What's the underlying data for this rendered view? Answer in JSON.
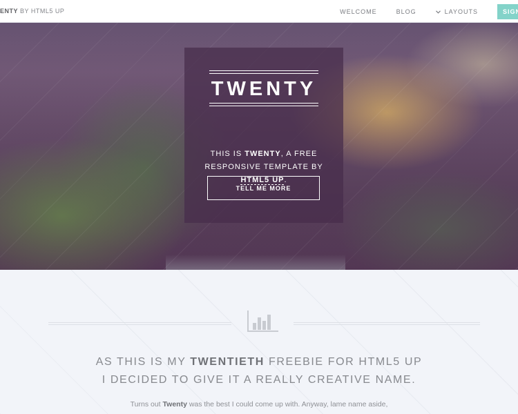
{
  "header": {
    "logo_main": "ENTY",
    "logo_by": " BY HTML5 UP",
    "nav": [
      {
        "label": "WELCOME"
      },
      {
        "label": "BLOG"
      },
      {
        "label": "LAYOUTS",
        "icon": "chevron-down-icon"
      }
    ],
    "signup_label": "SIGN"
  },
  "hero": {
    "title": "TWENTY",
    "text_1": "THIS IS ",
    "text_brand": "TWENTY",
    "text_2": ", A FREE RESPONSIVE TEMPLATE BY ",
    "text_link": "HTML5 UP",
    "text_3": ".",
    "button_label": "TELL ME MORE"
  },
  "content": {
    "icon": "bar-chart-icon",
    "headline_1": "AS THIS IS MY ",
    "headline_bold": "TWENTIETH",
    "headline_2": " FREEBIE FOR HTML5 UP",
    "headline_line2": "I DECIDED TO GIVE IT A REALLY CREATIVE NAME.",
    "para_1": "Turns out ",
    "para_bold": "Twenty",
    "para_2": " was the best I could come up with. Anyway, lame name aside,"
  },
  "colors": {
    "accent": "#83d3c9",
    "header_bg": "#ffffff",
    "content_bg": "#f2f4f9"
  }
}
